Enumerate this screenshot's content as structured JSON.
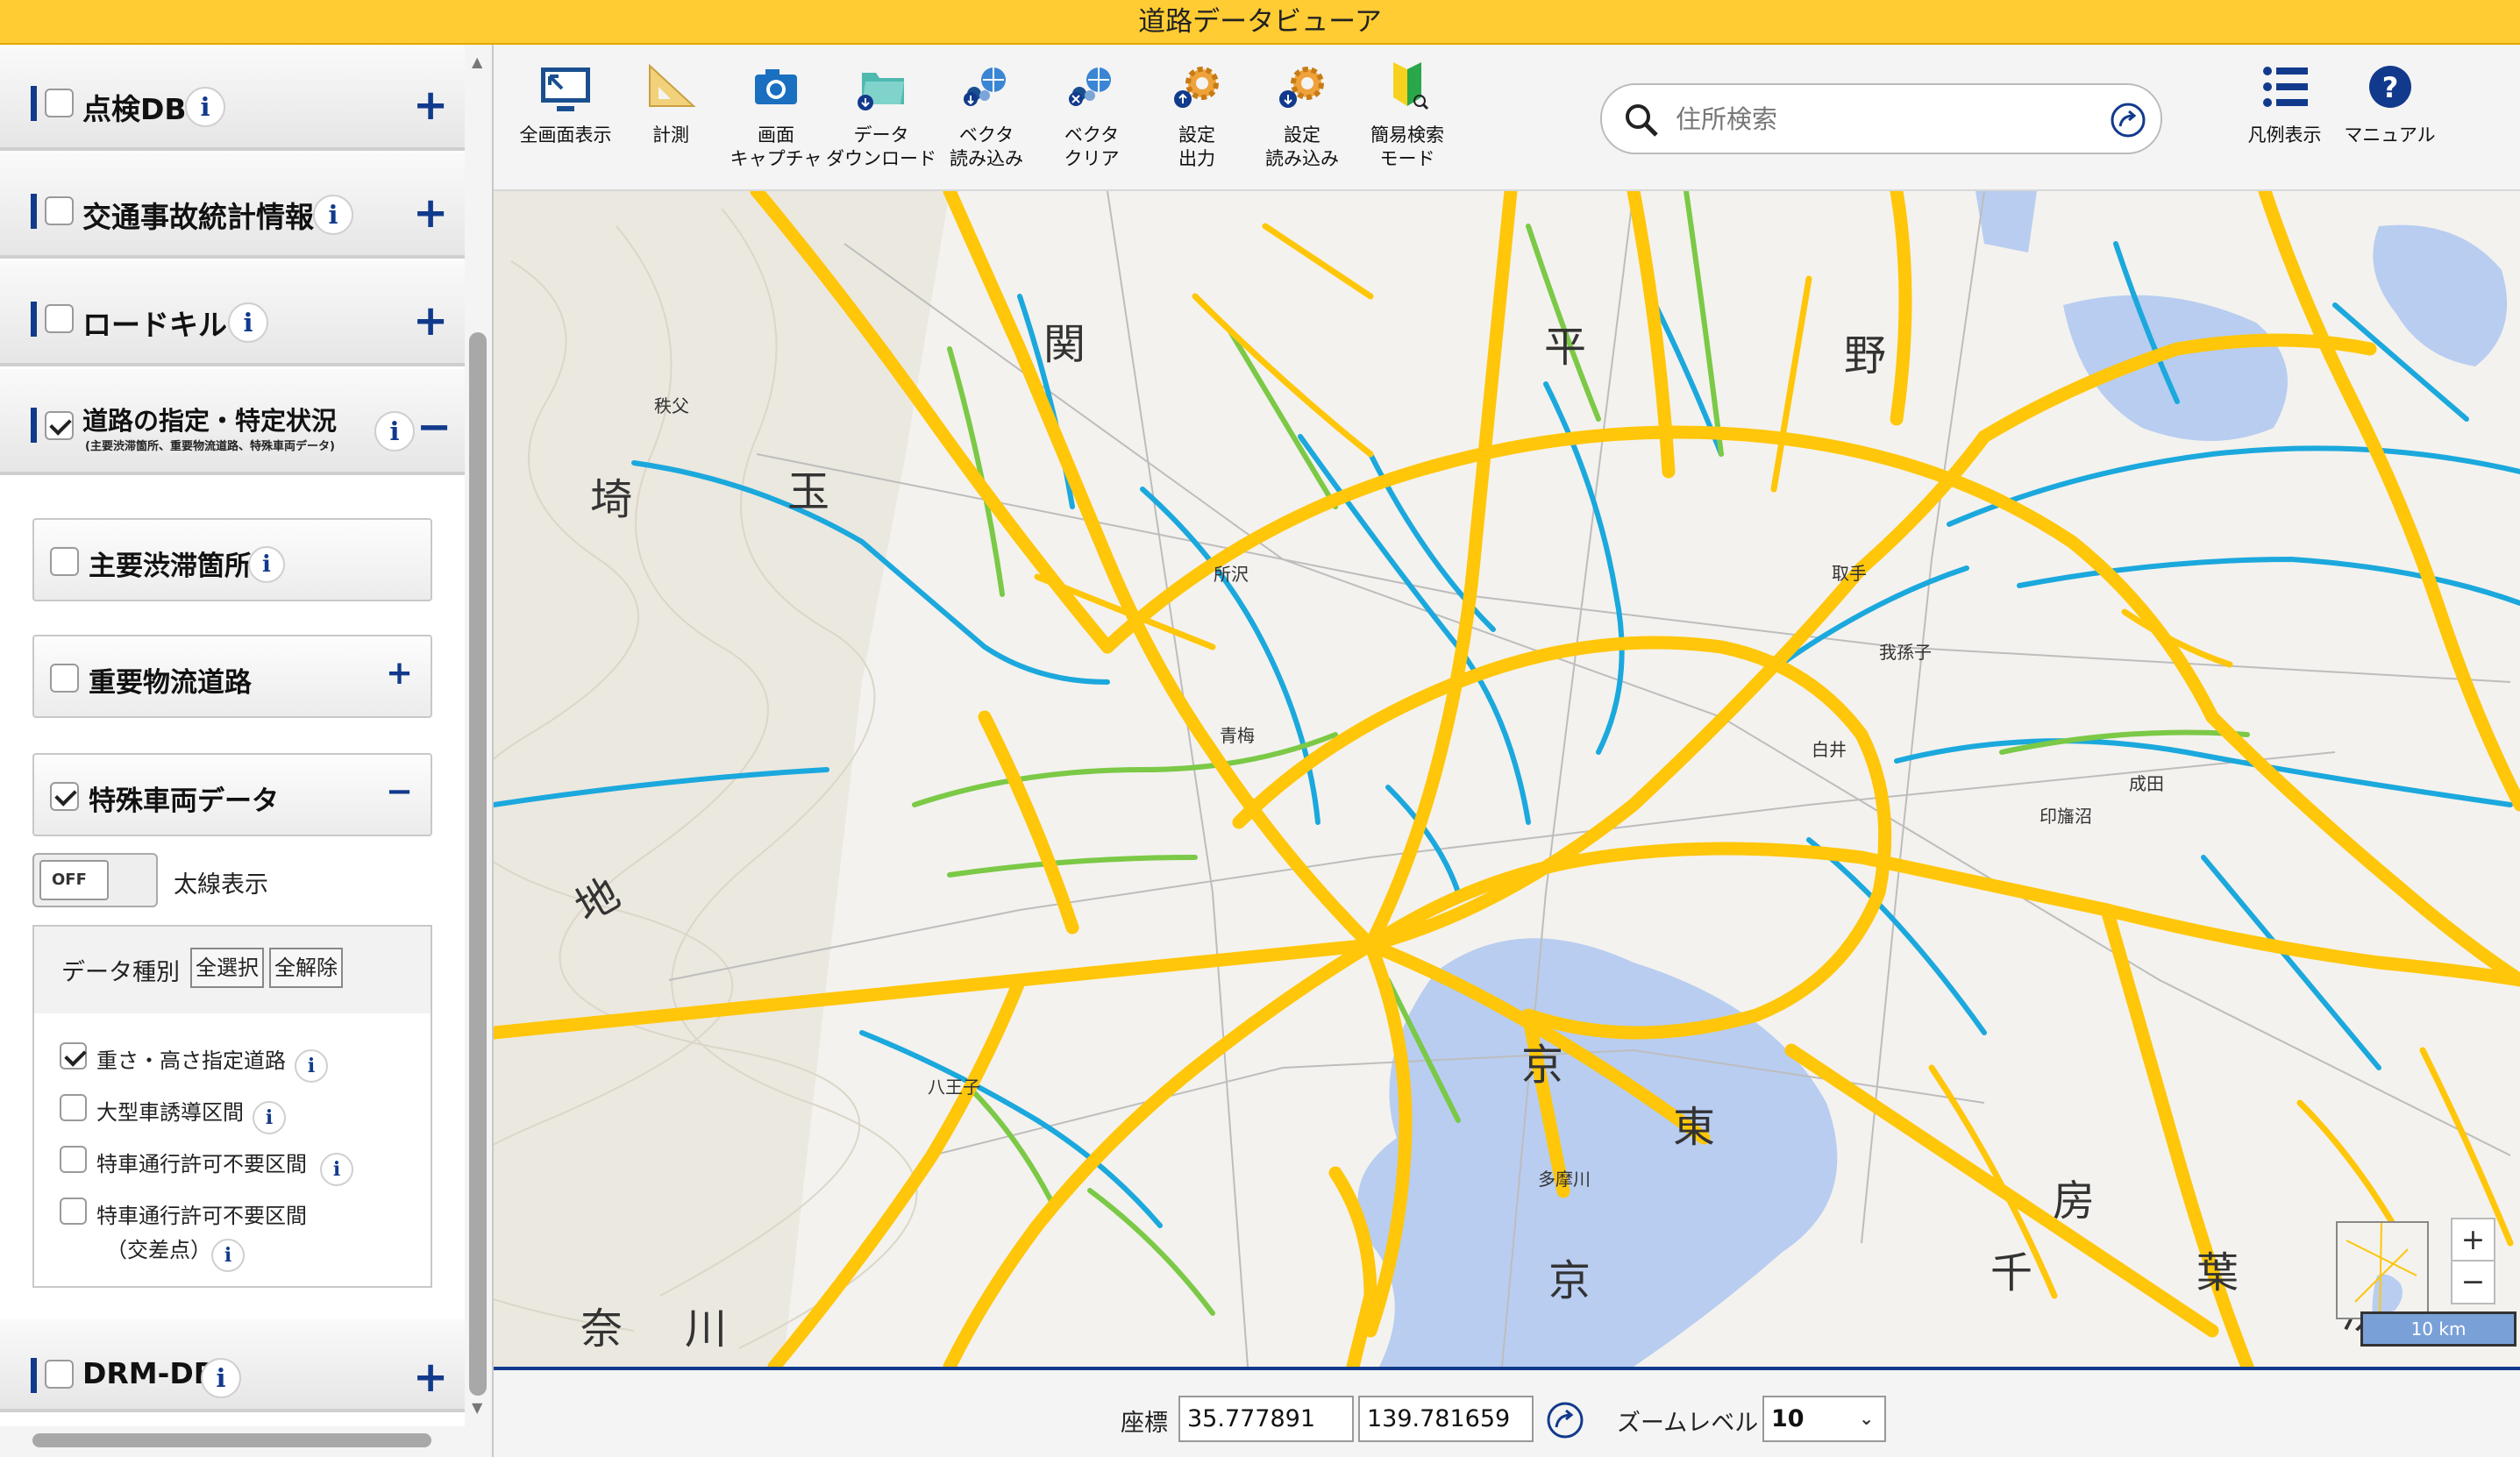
{
  "app": {
    "title": "道路データビューア"
  },
  "sidebar": {
    "layers": [
      {
        "label": "点検DB",
        "checked": false,
        "toggle": "+"
      },
      {
        "label": "交通事故統計情報",
        "checked": false,
        "toggle": "+"
      },
      {
        "label": "ロードキル",
        "checked": false,
        "toggle": "+"
      },
      {
        "label": "道路の指定・特定状況",
        "sublabel": "(主要渋滞箇所、重要物流道路、特殊車両データ)",
        "checked": true,
        "toggle": "−"
      }
    ],
    "sublayers": [
      {
        "label": "主要渋滞箇所",
        "checked": false
      },
      {
        "label": "重要物流道路",
        "checked": false,
        "toggle": "+"
      },
      {
        "label": "特殊車両データ",
        "checked": true,
        "toggle": "−"
      }
    ],
    "bold_line": {
      "switch_state": "OFF",
      "label": "太線表示"
    },
    "data_types": {
      "title": "データ種別",
      "select_all": "全選択",
      "clear_all": "全解除",
      "items": [
        {
          "label": "重さ・高さ指定道路",
          "checked": true
        },
        {
          "label": "大型車誘導区間",
          "checked": false
        },
        {
          "label": "特車通行許可不要区間",
          "checked": false
        },
        {
          "label": "特車通行許可不要区間",
          "label2": "（交差点）",
          "checked": false
        }
      ]
    },
    "drm": {
      "label": "DRM-DB",
      "checked": false,
      "toggle": "+"
    },
    "info_glyph": "i"
  },
  "toolbar": {
    "tools": [
      {
        "label": "全画面表示",
        "icon": "fullscreen-icon"
      },
      {
        "label": "計測",
        "icon": "ruler-icon"
      },
      {
        "label": "画面\nキャプチャ",
        "icon": "camera-icon"
      },
      {
        "label": "データ\nダウンロード",
        "icon": "folder-download-icon"
      },
      {
        "label": "ベクタ\n読み込み",
        "icon": "vector-load-icon"
      },
      {
        "label": "ベクタ\nクリア",
        "icon": "vector-clear-icon"
      },
      {
        "label": "設定\n出力",
        "icon": "settings-export-icon"
      },
      {
        "label": "設定\n読み込み",
        "icon": "settings-import-icon"
      },
      {
        "label": "簡易検索\nモード",
        "icon": "beginner-mark-icon"
      }
    ],
    "search_placeholder": "住所検索",
    "right_tools": [
      {
        "label": "凡例表示",
        "icon": "legend-list-icon"
      },
      {
        "label": "マニュアル",
        "icon": "help-icon"
      }
    ]
  },
  "map": {
    "colors": {
      "orange_route": "#ffc60a",
      "blue_route": "#1ba8dd",
      "green_route": "#7bc946",
      "water": "#b8cdf0",
      "land": "#f3f2ee"
    },
    "labels": [
      "関",
      "平",
      "野",
      "埼",
      "玉",
      "地",
      "東",
      "京",
      "千",
      "葉",
      "房",
      "奈",
      "川",
      "浜"
    ],
    "place_names": [
      "秩父",
      "青梅",
      "所沢",
      "成田",
      "印旛沼",
      "取手",
      "我孫子",
      "白井",
      "八王子",
      "多摩川"
    ],
    "scale_label": "10 km",
    "zoom_in": "+",
    "zoom_out": "−"
  },
  "statusbar": {
    "coord_label": "座標",
    "latitude": "35.777891",
    "longitude": "139.781659",
    "zoom_label": "ズームレベル",
    "zoom_value": "10"
  }
}
